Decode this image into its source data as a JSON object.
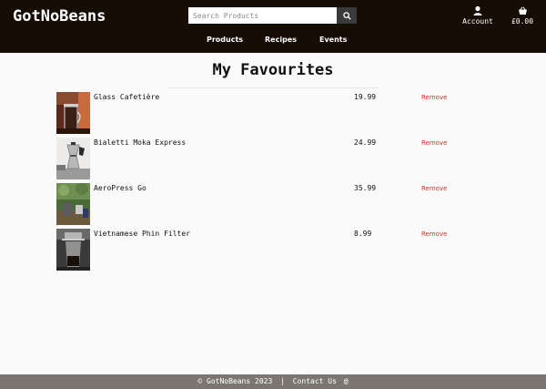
{
  "brand": "GotNoBeans",
  "search": {
    "placeholder": "Search Products",
    "icon": "search-icon"
  },
  "account": {
    "label": "Account",
    "icon": "user-icon"
  },
  "cart": {
    "total": "£0.00",
    "icon": "basket-icon"
  },
  "nav": [
    {
      "label": "Products"
    },
    {
      "label": "Recipes"
    },
    {
      "label": "Events"
    }
  ],
  "page_title": "My Favourites",
  "favourites": [
    {
      "name": "Glass Cafetière",
      "price": "19.99",
      "remove_label": "Remove"
    },
    {
      "name": "Bialetti Moka Express",
      "price": "24.99",
      "remove_label": "Remove"
    },
    {
      "name": "AeroPress Go",
      "price": "35.99",
      "remove_label": "Remove"
    },
    {
      "name": "Vietnamese Phin Filter",
      "price": "8.99",
      "remove_label": "Remove"
    }
  ],
  "footer": {
    "copyright": "© GotNoBeans 2023",
    "separator": "|",
    "contact": "Contact Us",
    "contact_icon": "at-icon"
  },
  "colors": {
    "header_bg": "#160d05",
    "footer_bg": "#7c7670",
    "remove": "#c0392b"
  }
}
